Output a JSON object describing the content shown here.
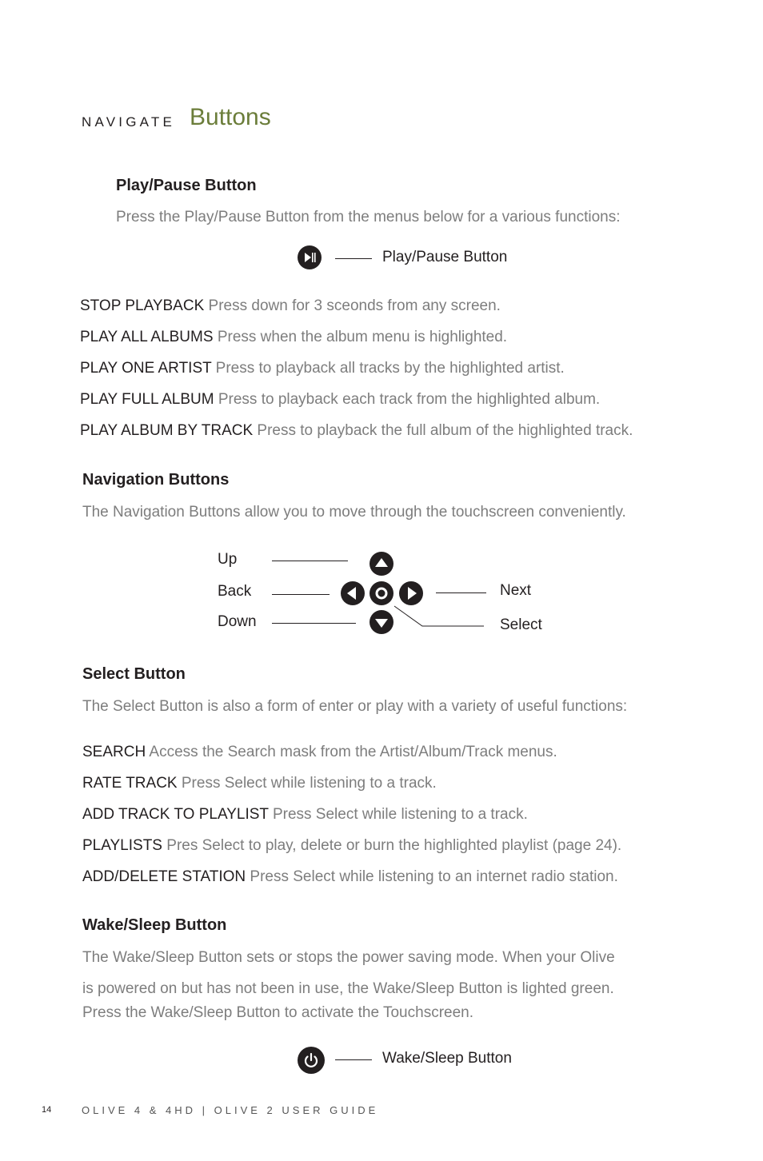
{
  "header": {
    "section": "NAVIGATE",
    "title": "Buttons"
  },
  "play_pause": {
    "heading": "Play/Pause Button",
    "intro": "Press the Play/Pause Button from the menus below for a various functions:",
    "diagram_label": "Play/Pause Button",
    "icon": "play-pause-icon",
    "items": [
      {
        "term": "STOP PLAYBACK",
        "desc": "Press down for 3 sceonds from any screen."
      },
      {
        "term": "PLAY ALL ALBUMS",
        "desc": "Press when the album menu is highlighted."
      },
      {
        "term": "PLAY ONE ARTIST",
        "desc": "Press to playback all tracks by the highlighted artist."
      },
      {
        "term": "PLAY FULL ALBUM",
        "desc": "Press to playback each track from the highlighted album."
      },
      {
        "term": "PLAY ALBUM BY TRACK",
        "desc": "Press to playback the full album of the highlighted track."
      }
    ]
  },
  "navigation": {
    "heading": "Navigation Buttons",
    "intro": "The Navigation Buttons allow you to move through the touchscreen conveniently.",
    "labels": {
      "up": "Up",
      "back": "Back",
      "down": "Down",
      "next": "Next",
      "select": "Select"
    }
  },
  "select": {
    "heading": "Select Button",
    "intro": "The Select Button is also a form of enter or play with a variety of useful functions:",
    "items": [
      {
        "term": "SEARCH",
        "desc": "Access the Search mask from the Artist/Album/Track menus."
      },
      {
        "term": "RATE TRACK",
        "desc": "Press Select while listening to a track."
      },
      {
        "term": "ADD TRACK TO PLAYLIST",
        "desc": "Press Select while listening to a track."
      },
      {
        "term": "PLAYLISTS",
        "desc": "Pres Select to play, delete or burn the highlighted playlist (page 24)."
      },
      {
        "term": "ADD/DELETE STATION",
        "desc": "Press Select while listening to an internet radio station."
      }
    ]
  },
  "wake_sleep": {
    "heading": "Wake/Sleep Button",
    "para_line1": "The Wake/Sleep Button sets or stops the power saving mode. When your Olive",
    "para_line2": "is powered on but has not been in use, the Wake/Sleep Button is lighted green.",
    "para_line3": "Press the Wake/Sleep Button to activate the Touchscreen.",
    "diagram_label": "Wake/Sleep Button",
    "icon": "power-icon"
  },
  "footer": {
    "page_number": "14",
    "guide_title": "OLIVE 4 & 4HD | OLIVE 2 USER GUIDE"
  },
  "colors": {
    "accent": "#6b7d3a",
    "text_dark": "#231f20",
    "text_gray": "#7d7d7d"
  }
}
